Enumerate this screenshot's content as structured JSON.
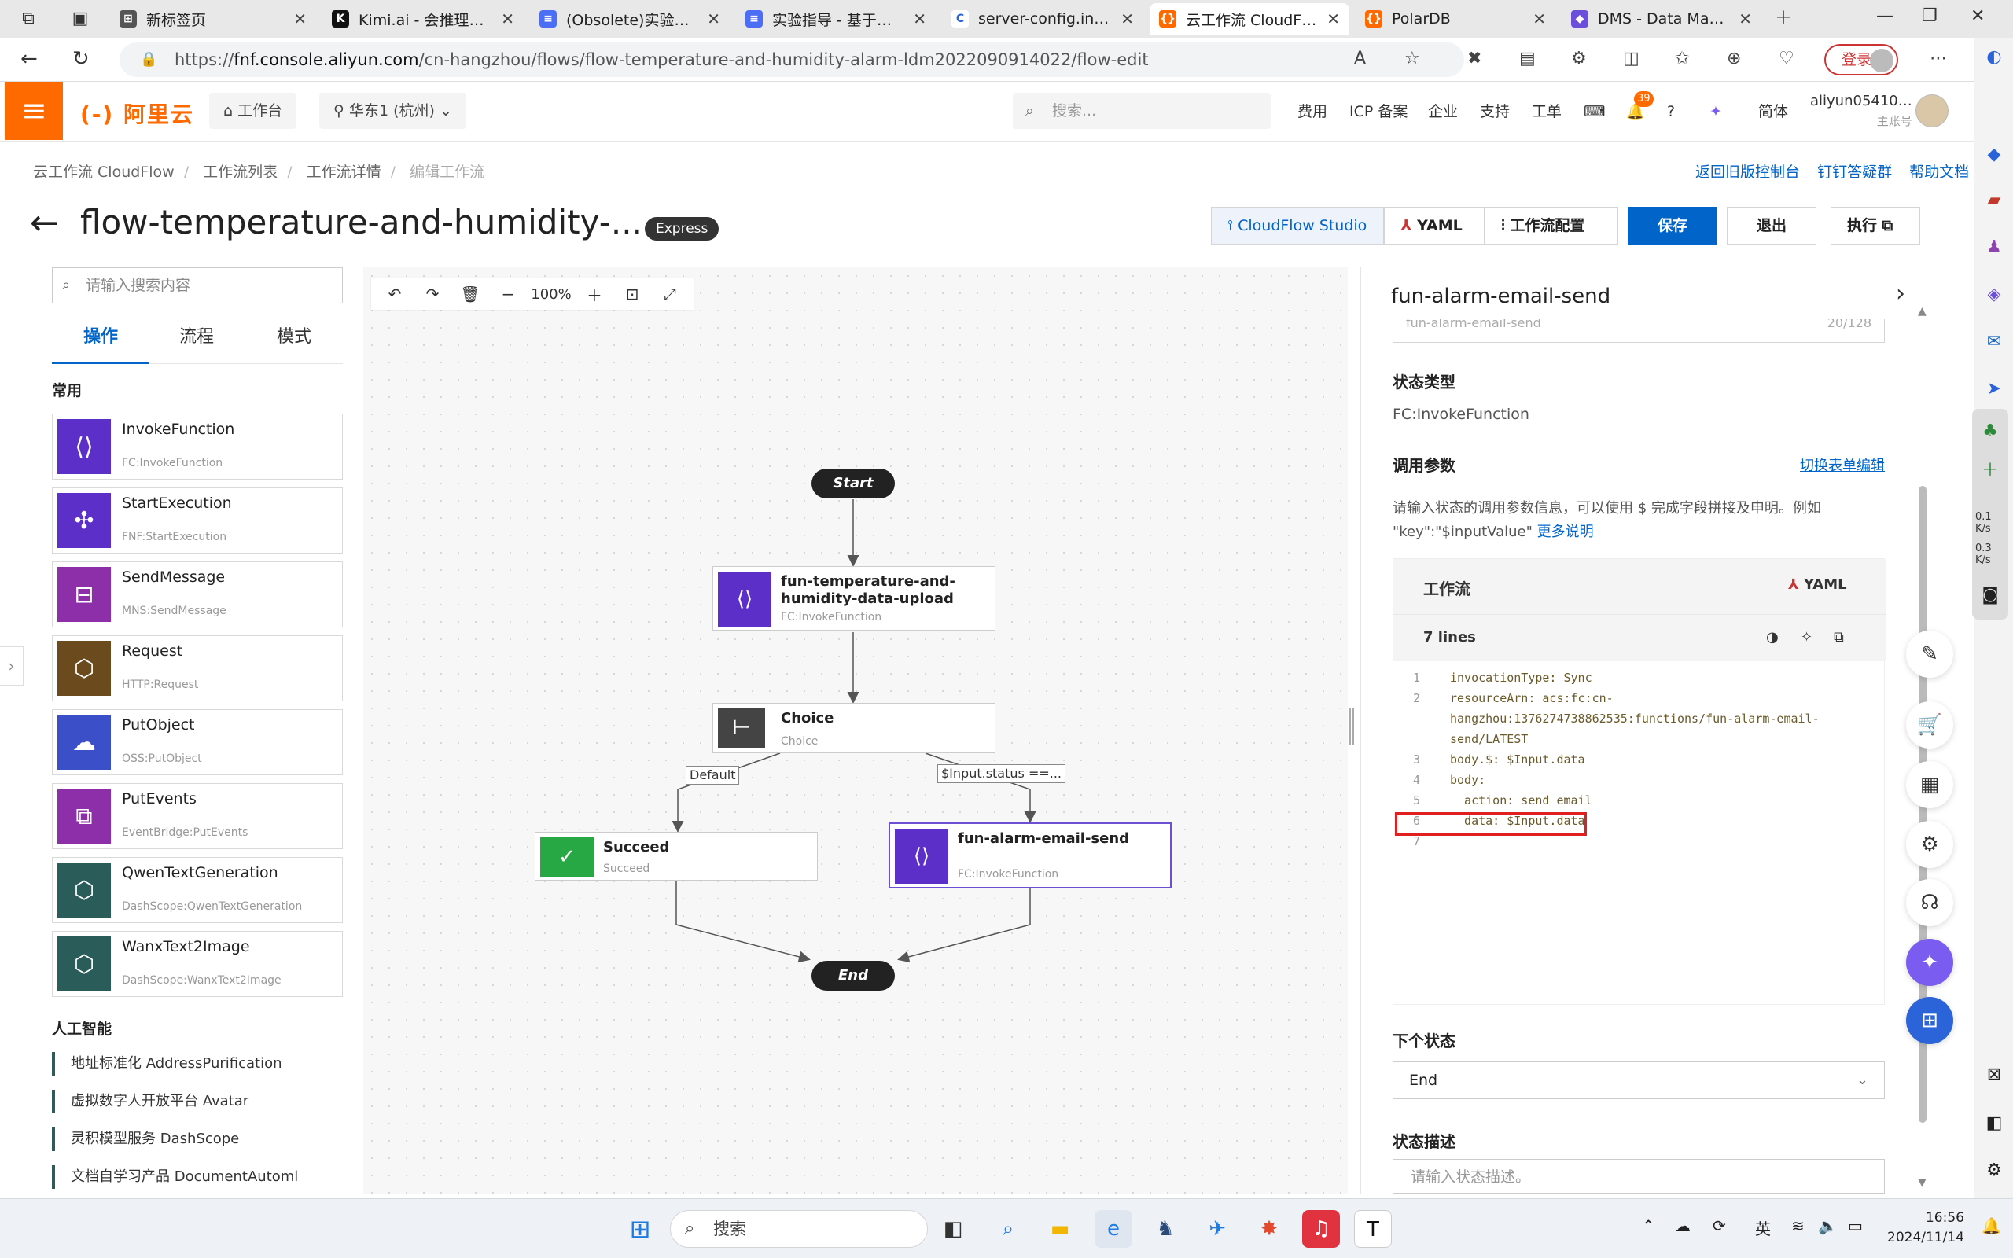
{
  "browser": {
    "tabs": [
      {
        "title": "新标签页",
        "fav": "#555",
        "favtext": "⊞"
      },
      {
        "title": "Kimi.ai - 会推理解析…",
        "fav": "#111",
        "favtext": "K"
      },
      {
        "title": "(Obsolete)实验指导…",
        "fav": "#4c6ef5",
        "favtext": "≡"
      },
      {
        "title": "实验指导 - 基于阿里…",
        "fav": "#4c6ef5",
        "favtext": "≡"
      },
      {
        "title": "server-config.ini · ma…",
        "fav": "#fff",
        "favtext": "C"
      },
      {
        "title": "云工作流 CloudFlow",
        "fav": "#ff6a00",
        "favtext": "{}"
      },
      {
        "title": "PolarDB",
        "fav": "#ff6a00",
        "favtext": "{}"
      },
      {
        "title": "DMS - Data Manage…",
        "fav": "#6b4fd8",
        "favtext": "◆"
      }
    ],
    "url_prefix": "https://",
    "url_host": "fnf.console.aliyun.com",
    "url_path": "/cn-hangzhou/flows/flow-temperature-and-humidity-alarm-ldm2022090914022/flow-edit",
    "login_label": "登录"
  },
  "topbar": {
    "logo": "阿里云",
    "workbench": "工作台",
    "region": "华东1 (杭州)",
    "search_placeholder": "搜索...",
    "nav": [
      "费用",
      "ICP 备案",
      "企业",
      "支持",
      "工单"
    ],
    "notif_count": "39",
    "lang": "简体",
    "user": "aliyun05410…",
    "user_sub": "主账号"
  },
  "breadcrumb": [
    "云工作流 CloudFlow",
    "工作流列表",
    "工作流详情",
    "编辑工作流"
  ],
  "help_links": [
    "返回旧版控制台",
    "钉钉答疑群",
    "帮助文档"
  ],
  "header": {
    "title": "flow-temperature-and-humidity-...",
    "badge": "Express",
    "btn_studio": "CloudFlow Studio",
    "btn_yaml": "YAML",
    "btn_config": "工作流配置",
    "btn_save": "保存",
    "btn_exit": "退出",
    "btn_run": "执行"
  },
  "left": {
    "search_placeholder": "请输入搜索内容",
    "tabs": [
      "操作",
      "流程",
      "模式"
    ],
    "section_common": "常用",
    "cards": [
      {
        "name": "InvokeFunction",
        "sub": "FC:InvokeFunction",
        "color": "#5b2fc8",
        "icon": "⟨⟩"
      },
      {
        "name": "StartExecution",
        "sub": "FNF:StartExecution",
        "color": "#5b2fc8",
        "icon": "✣"
      },
      {
        "name": "SendMessage",
        "sub": "MNS:SendMessage",
        "color": "#8d2fa8",
        "icon": "⊟"
      },
      {
        "name": "Request",
        "sub": "HTTP:Request",
        "color": "#6b4a1e",
        "icon": "⬡"
      },
      {
        "name": "PutObject",
        "sub": "OSS:PutObject",
        "color": "#3a4fc8",
        "icon": "☁"
      },
      {
        "name": "PutEvents",
        "sub": "EventBridge:PutEvents",
        "color": "#8d2fa8",
        "icon": "⧉"
      },
      {
        "name": "QwenTextGeneration",
        "sub": "DashScope:QwenTextGeneration",
        "color": "#2a5c5a",
        "icon": "⬡"
      },
      {
        "name": "WanxText2Image",
        "sub": "DashScope:WanxText2Image",
        "color": "#2a5c5a",
        "icon": "⬡"
      }
    ],
    "section_ai": "人工智能",
    "ai_items": [
      "地址标准化 AddressPurification",
      "虚拟数字人开放平台 Avatar",
      "灵积模型服务 DashScope",
      "文档自学习产品 DocumentAutoml"
    ]
  },
  "canvas": {
    "zoom": "100%",
    "start": "Start",
    "end": "End",
    "nodes": {
      "upload_name": "fun-temperature-and-humidity-data-upload",
      "upload_sub": "FC:InvokeFunction",
      "choice_name": "Choice",
      "choice_sub": "Choice",
      "succeed_name": "Succeed",
      "succeed_sub": "Succeed",
      "alarm_name": "fun-alarm-email-send",
      "alarm_sub": "FC:InvokeFunction"
    },
    "edge_default": "Default",
    "edge_cond": "$Input.status ==..."
  },
  "panel": {
    "title": "fun-alarm-email-send",
    "name_value": "fun-alarm-email-send",
    "name_count": "20/128",
    "state_type_label": "状态类型",
    "state_type_value": "FC:InvokeFunction",
    "params_label": "调用参数",
    "switch_form": "切换表单编辑",
    "hint": "请输入状态的调用参数信息，可以使用 $ 完成字段拼接及申明。例如 \"key\":\"$inputValue\"",
    "hint_link": "更多说明",
    "editor_title": "工作流",
    "editor_yaml": "YAML",
    "lines_label": "7 lines",
    "code": [
      {
        "no": "1",
        "text": "invocationType: Sync"
      },
      {
        "no": "2",
        "text": "resourceArn: acs:fc:cn-"
      },
      {
        "no": "",
        "text": "hangzhou:1376274738862535:functions/fun-alarm-email-"
      },
      {
        "no": "",
        "text": "send/LATEST"
      },
      {
        "no": "3",
        "text": "body.$: $Input.data"
      },
      {
        "no": "4",
        "text": "body:"
      },
      {
        "no": "5",
        "text": "  action: send_email"
      },
      {
        "no": "6",
        "text": "  data: $Input.data"
      },
      {
        "no": "7",
        "text": ""
      }
    ],
    "next_label": "下个状态",
    "next_value": "End",
    "desc_label": "状态描述",
    "desc_placeholder": "请输入状态描述。"
  },
  "netmon": [
    "0.1 K/s",
    "0.3 K/s"
  ],
  "taskbar": {
    "search": "搜索",
    "lang": "英",
    "time": "16:56",
    "date": "2024/11/14"
  }
}
